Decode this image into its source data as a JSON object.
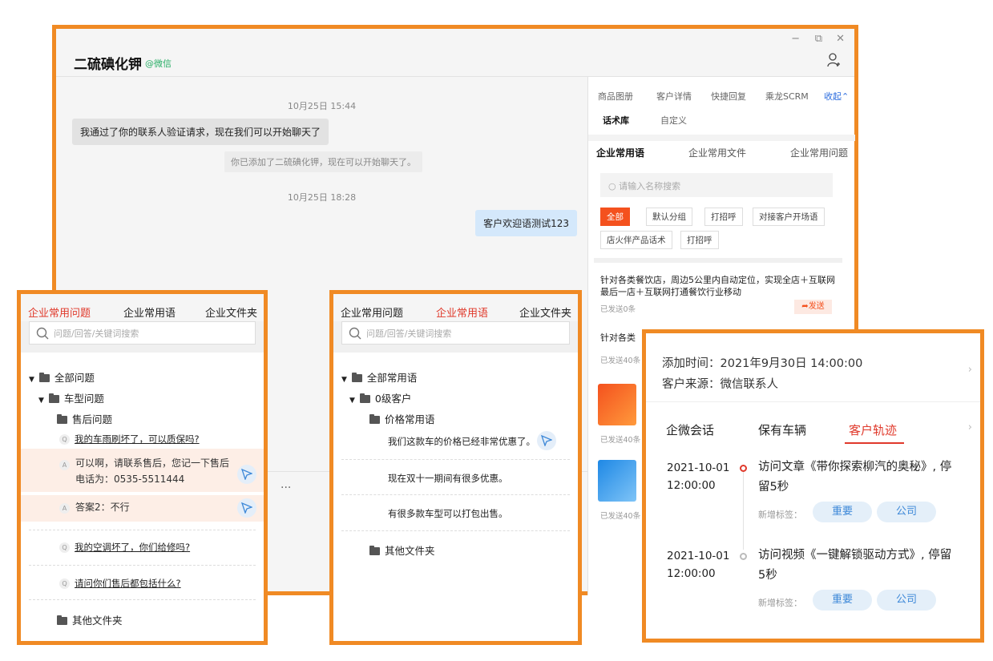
{
  "main": {
    "title": "二硫碘化钾",
    "platform": "@微信",
    "window_controls": [
      "−",
      "⧉",
      "✕"
    ],
    "messages": {
      "time1": "10月25日 15:44",
      "incoming": "我通过了你的联系人验证请求，现在我们可以开始聊天了",
      "system": "你已添加了二硫碘化钾，现在可以开始聊天了。",
      "time2": "10月25日 18:28",
      "outgoing": "客户欢迎语测试123"
    },
    "more": "···"
  },
  "side": {
    "tabs": [
      "商品图册",
      "客户详情",
      "快捷回复",
      "乘龙SCRM"
    ],
    "collapse": "收起",
    "subtabs": [
      "话术库",
      "自定义"
    ],
    "content_tabs": [
      "企业常用语",
      "企业常用文件",
      "企业常用问题"
    ],
    "search_placeholder": "请输入名称搜索",
    "tags": [
      "全部",
      "默认分组",
      "打招呼",
      "对接客户开场语",
      "店火伴产品话术",
      "打招呼"
    ],
    "item1_text": "针对各类餐饮店，周边5公里内自动定位，实现全店＋互联网最后一店＋互联网打通餐饮行业移动",
    "item1_sent": "已发送0条",
    "send_label": "发送",
    "item2_text": "针对各类",
    "item2_sent": "已发送40条",
    "item3_sent": "已发送40条",
    "item4_sent": "已发送40条"
  },
  "panel1": {
    "tabs": [
      "企业常用问题",
      "企业常用语",
      "企业文件夹"
    ],
    "search_placeholder": "问题/回答/关键词搜索",
    "tree": {
      "root": "全部问题",
      "sub": "车型问题",
      "subsub": "售后问题",
      "q1": "我的车雨刷坏了，可以质保吗?",
      "a1_line1": "可以啊，请联系售后，您记一下售后",
      "a1_line2": "电话为：0535-5511444",
      "a2": "答案2：不行",
      "q2": "我的空调坏了，你们给修吗?",
      "q3": "请问你们售后都包括什么?",
      "other": "其他文件夹"
    },
    "badge_q": "Q",
    "badge_a": "A"
  },
  "panel2": {
    "tabs": [
      "企业常用问题",
      "企业常用语",
      "企业文件夹"
    ],
    "search_placeholder": "问题/回答/关键词搜索",
    "tree": {
      "root": "全部常用语",
      "sub": "0级客户",
      "subsub": "价格常用语",
      "p1": "我们这款车的价格已经非常优惠了。",
      "p2": "现在双十一期间有很多优惠。",
      "p3": "有很多款车型可以打包出售。",
      "other": "其他文件夹"
    }
  },
  "traj": {
    "add_time": "添加时间：2021年9月30日  14:00:00",
    "source": "客户来源：微信联系人",
    "tabs": [
      "企微会话",
      "保有车辆",
      "客户轨迹"
    ],
    "events": [
      {
        "date": "2021-10-01",
        "time": "12:00:00",
        "line1": "访问文章《带你探索柳汽的奥秘》, 停",
        "line2": "留5秒"
      },
      {
        "date": "2021-10-01",
        "time": "12:00:00",
        "line1": "访问视频《一键解锁驱动方式》, 停留",
        "line2": "5秒"
      }
    ],
    "label": "新增标签：",
    "pills": [
      "重要",
      "公司"
    ],
    "chevron": "›"
  }
}
